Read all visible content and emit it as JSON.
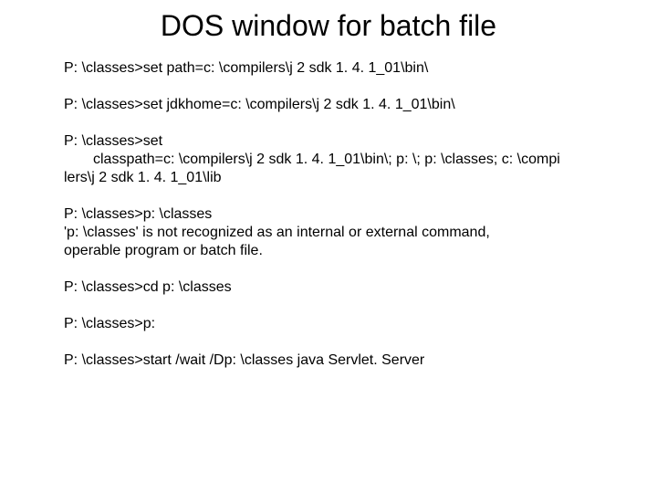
{
  "title": "DOS window for batch file",
  "blocks": {
    "b1": {
      "l1": "P: \\classes>set path=c: \\compilers\\j 2 sdk 1. 4. 1_01\\bin\\"
    },
    "b2": {
      "l1": "P: \\classes>set jdkhome=c: \\compilers\\j 2 sdk 1. 4. 1_01\\bin\\"
    },
    "b3": {
      "l1": "P: \\classes>set",
      "l2": "classpath=c: \\compilers\\j 2 sdk 1. 4. 1_01\\bin\\; p: \\; p: \\classes; c: \\compi",
      "l3": "lers\\j 2 sdk 1. 4. 1_01\\lib"
    },
    "b4": {
      "l1": "P: \\classes>p: \\classes",
      "l2": "'p: \\classes' is not recognized as an internal or external command,",
      "l3": "operable program or batch file."
    },
    "b5": {
      "l1": "P: \\classes>cd p: \\classes"
    },
    "b6": {
      "l1": "P: \\classes>p:"
    },
    "b7": {
      "l1": "P: \\classes>start /wait /Dp: \\classes java Servlet. Server"
    }
  }
}
